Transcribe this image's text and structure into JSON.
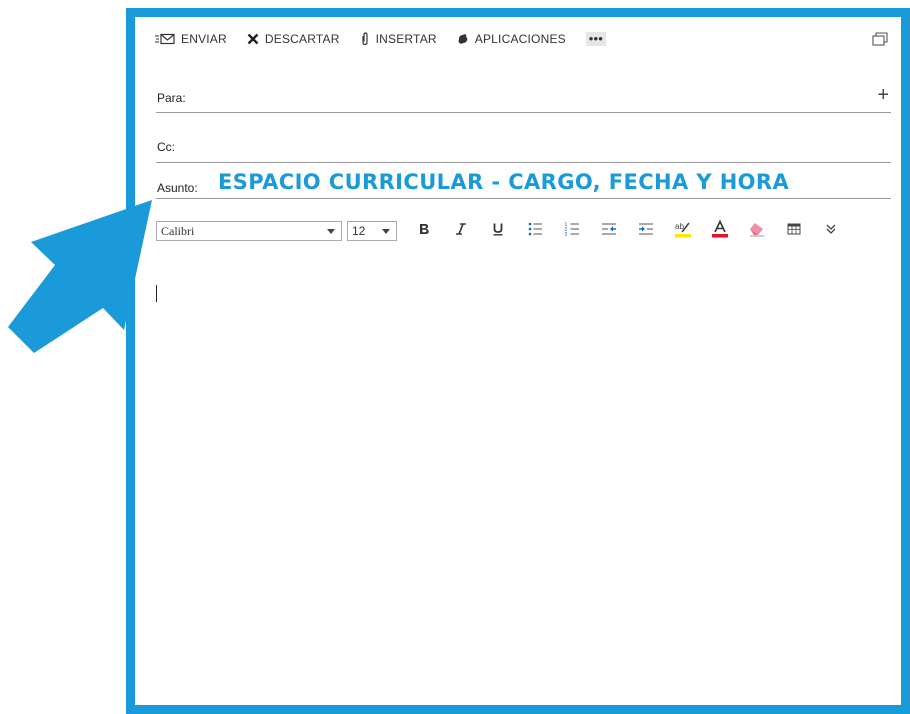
{
  "toolbar": {
    "send_label": "ENVIAR",
    "discard_label": "DESCARTAR",
    "insert_label": "INSERTAR",
    "apps_label": "APLICACIONES",
    "more_label": "•••"
  },
  "fields": {
    "to_label": "Para:",
    "to_value": "",
    "cc_label": "Cc:",
    "cc_value": "",
    "subject_label": "Asunto:",
    "subject_value": "ESPACIO CURRICULAR - CARGO, FECHA Y HORA",
    "add_recipient": "+"
  },
  "formatting": {
    "font_value": "Calibri",
    "size_value": "12"
  },
  "icons": [
    "send-icon",
    "discard-icon",
    "attach-icon",
    "apps-icon",
    "popout-icon",
    "bold-icon",
    "italic-icon",
    "underline-icon",
    "bullets-icon",
    "numbering-icon",
    "indent-icon",
    "outdent-icon",
    "highlight-icon",
    "font-color-icon",
    "clear-format-icon",
    "table-icon",
    "more-formatting-icon"
  ],
  "colors": {
    "accent": "#1a9ad9",
    "highlight": "#ffe600",
    "font_color": "#e81123"
  }
}
